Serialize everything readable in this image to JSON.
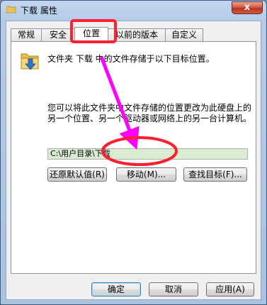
{
  "window": {
    "title": "下载 属性",
    "close_label": "x"
  },
  "tabs": [
    {
      "label": "常规"
    },
    {
      "label": "安全"
    },
    {
      "label": "位置"
    },
    {
      "label": "以前的版本"
    },
    {
      "label": "自定义"
    }
  ],
  "location": {
    "info_text": "文件夹 下载 中的文件存储于以下目标位置。",
    "help_text": "您可以将此文件夹中文件存储的位置更改为此硬盘上的另一个位置、另一个驱动器或网络上的另一台计算机。",
    "path_value": "C:\\用户目录\\下载",
    "restore_default_label": "还原默认值(R)",
    "move_label": "移动(M)...",
    "find_target_label": "查找目标(F)..."
  },
  "footer": {
    "ok_label": "确定",
    "cancel_label": "取消",
    "apply_label": "应用(A)"
  },
  "colors": {
    "highlight_red": "#ff1f2f",
    "arrow_magenta": "#ff00ff",
    "path_field_bg": "#d9ecd3",
    "window_frame": "#b3cbe6"
  },
  "icons": {
    "title": "folder-icon",
    "location": "folder-download-icon"
  }
}
